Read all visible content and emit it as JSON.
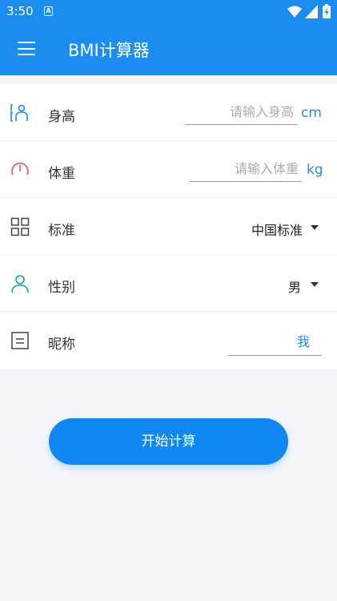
{
  "status_bar": {
    "time": "3:50",
    "notification_icon_letter": "A"
  },
  "app_bar": {
    "title": "BMI计算器"
  },
  "form": {
    "height": {
      "label": "身高",
      "placeholder": "请输入身高",
      "unit": "cm"
    },
    "weight": {
      "label": "体重",
      "placeholder": "请输入体重",
      "unit": "kg"
    },
    "standard": {
      "label": "标准",
      "value": "中国标准"
    },
    "gender": {
      "label": "性别",
      "value": "男"
    },
    "nickname": {
      "label": "昵称",
      "value": "我"
    }
  },
  "actions": {
    "calculate_label": "开始计算"
  },
  "colors": {
    "primary": "#1b8cf0",
    "button": "#1187f4",
    "weight_icon": "#e4515f",
    "gender_icon": "#1aa3a0",
    "background": "#f4f5f9"
  },
  "icons": {
    "menu": "menu-icon",
    "height": "height-person-icon",
    "weight": "gauge-icon",
    "standard": "grid-icon",
    "gender": "person-icon",
    "nickname": "note-icon"
  }
}
